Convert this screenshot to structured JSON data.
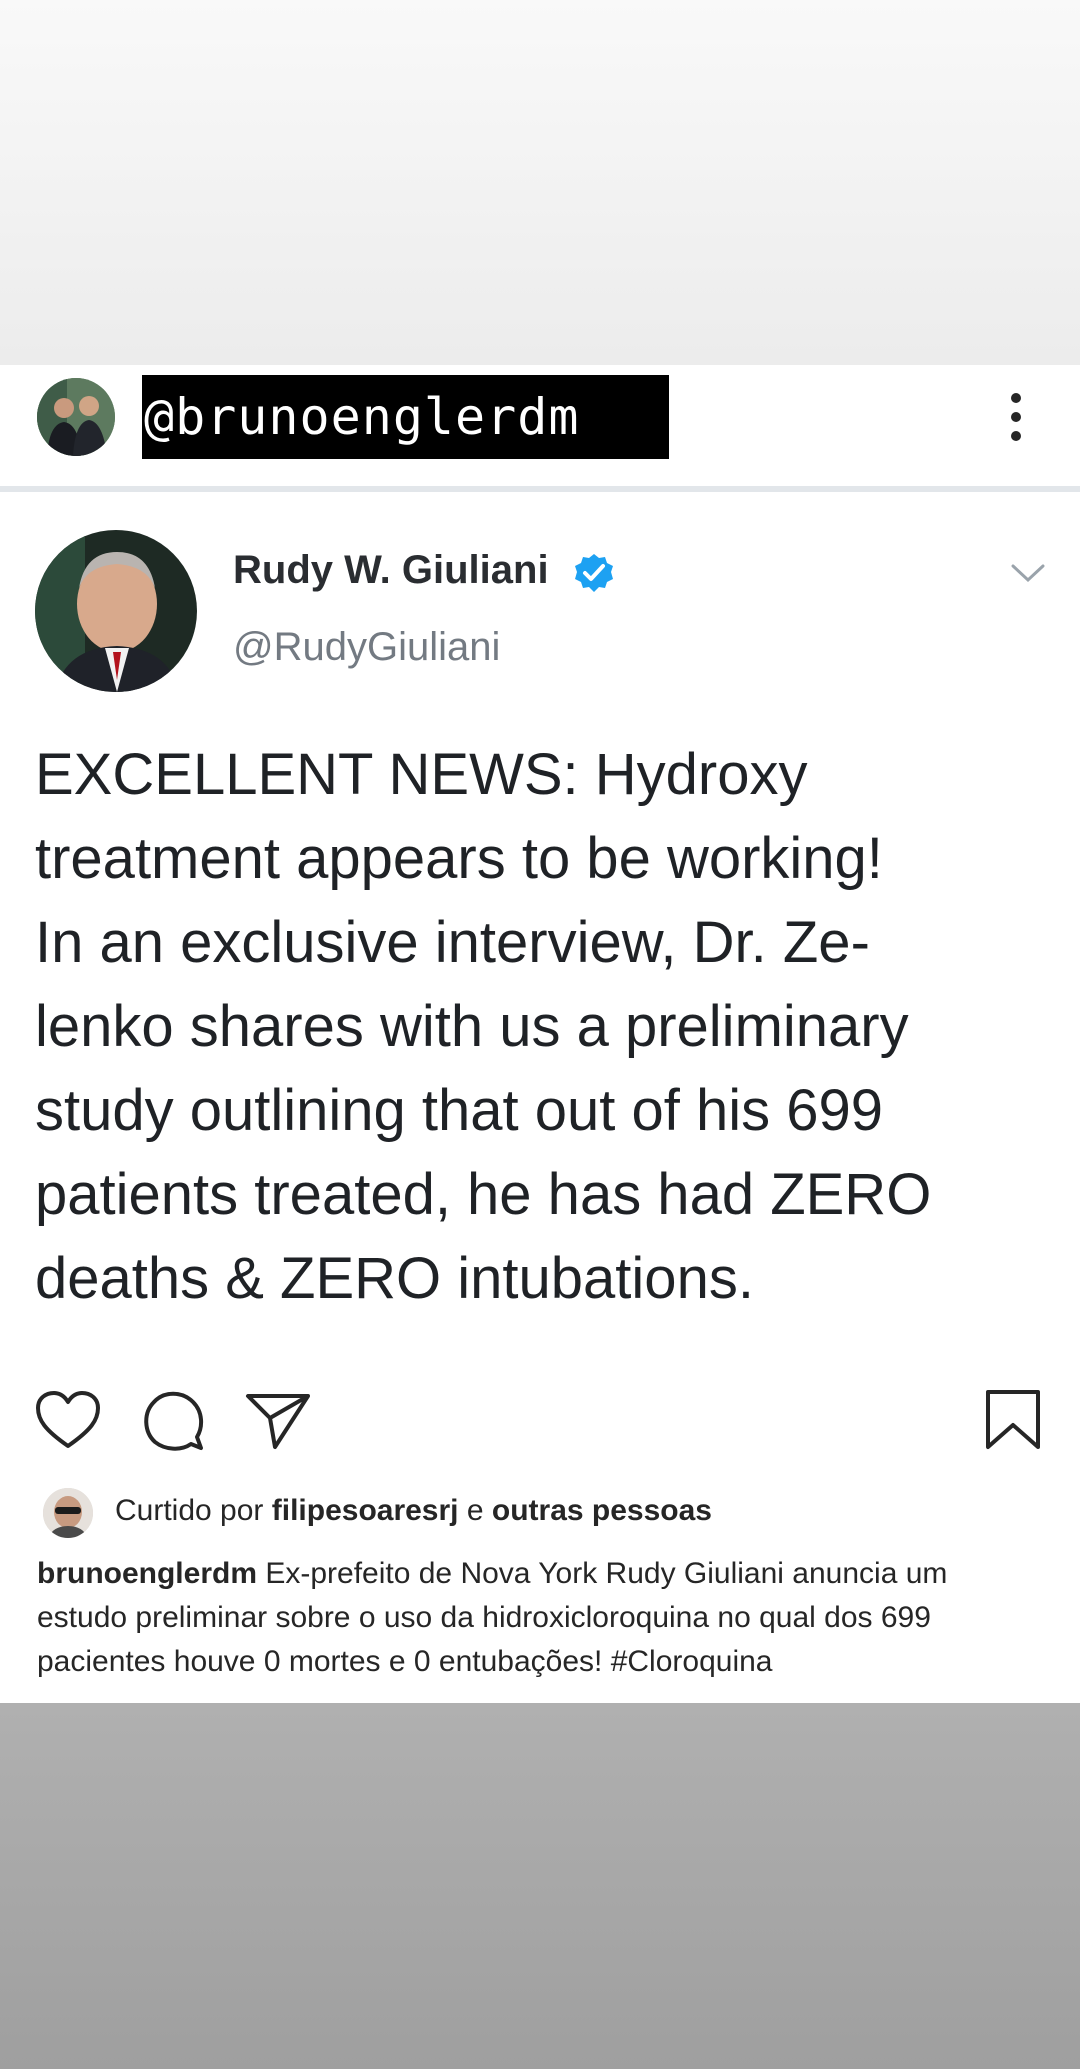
{
  "header": {
    "handle_tag": "@brunoenglerdm"
  },
  "tweet": {
    "name": "Rudy W. Giuliani",
    "handle": "@RudyGiuliani",
    "body_lines": [
      "EXCELLENT NEWS: Hydroxy",
      "treatment appears to be working!",
      "In an exclusive interview, Dr. Ze-",
      "lenko shares with us a preliminary",
      "study outlining that out of his 699",
      "patients treated, he has had ZERO",
      "deaths & ZERO intubations."
    ]
  },
  "likes": {
    "prefix": "Curtido por ",
    "user": "filipesoaresrj",
    "conjunction": " e ",
    "others": "outras pessoas"
  },
  "caption": {
    "author": "brunoenglerdm",
    "line1": " Ex-prefeito de Nova York Rudy Giuliani anuncia um",
    "line2": "estudo preliminar sobre o uso da hidroxicloroquina no qual dos 699",
    "line3": "pacientes houve 0 mortes e 0 entubações! #Cloroquina"
  },
  "colors": {
    "verified": "#1da1f2",
    "tag_background": "#000000"
  },
  "icons": [
    "more-vertical-icon",
    "verified-badge-icon",
    "chevron-down-icon",
    "heart-icon",
    "comment-icon",
    "share-icon",
    "bookmark-icon"
  ]
}
